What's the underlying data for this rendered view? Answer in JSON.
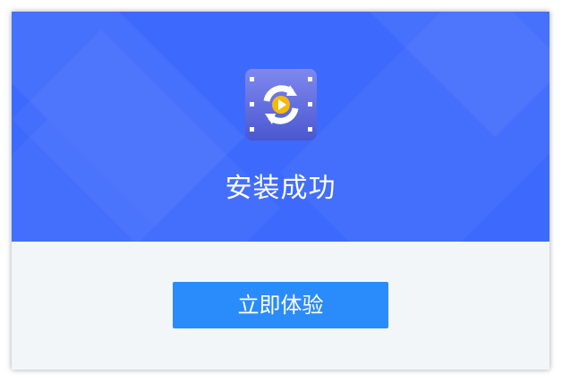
{
  "dialog": {
    "title": "安装成功",
    "primary_button_label": "立即体验",
    "app_icon": "film-reel-play-icon"
  },
  "colors": {
    "hero_background": "#3d6afc",
    "footer_background": "#f3f6f8",
    "button_background": "#2a8bfb",
    "icon_background": "#5a67dd",
    "play_accent": "#f5b90d",
    "text_light": "#ffffff"
  }
}
